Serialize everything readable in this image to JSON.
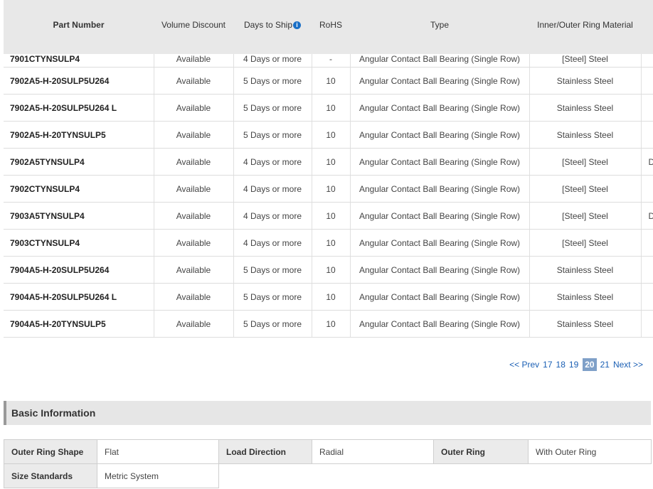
{
  "table": {
    "headers": {
      "part_number": "Part Number",
      "volume_discount": "Volume Discount",
      "days_to_ship": "Days to Ship",
      "rohs": "RoHS",
      "type": "Type",
      "ring_material": "Inner/Outer Ring Material"
    },
    "info_icon_glyph": "i",
    "rows": [
      {
        "part": "7901CTYNSULP4",
        "discount": "Available",
        "ship": "4 Days or more",
        "rohs": "-",
        "type": "Angular Contact Ball Bearing (Single Row)",
        "material": "[Steel] Steel",
        "extra": ""
      },
      {
        "part": "7902A5-H-20SULP5U264",
        "discount": "Available",
        "ship": "5 Days or more",
        "rohs": "10",
        "type": "Angular Contact Ball Bearing (Single Row)",
        "material": "Stainless Steel",
        "extra": ""
      },
      {
        "part": "7902A5-H-20SULP5U264 L",
        "discount": "Available",
        "ship": "5 Days or more",
        "rohs": "10",
        "type": "Angular Contact Ball Bearing (Single Row)",
        "material": "Stainless Steel",
        "extra": ""
      },
      {
        "part": "7902A5-H-20TYNSULP5",
        "discount": "Available",
        "ship": "5 Days or more",
        "rohs": "10",
        "type": "Angular Contact Ball Bearing (Single Row)",
        "material": "Stainless Steel",
        "extra": ""
      },
      {
        "part": "7902A5TYNSULP4",
        "discount": "Available",
        "ship": "4 Days or more",
        "rohs": "10",
        "type": "Angular Contact Ball Bearing (Single Row)",
        "material": "[Steel] Steel",
        "extra": "D"
      },
      {
        "part": "7902CTYNSULP4",
        "discount": "Available",
        "ship": "4 Days or more",
        "rohs": "10",
        "type": "Angular Contact Ball Bearing (Single Row)",
        "material": "[Steel] Steel",
        "extra": ""
      },
      {
        "part": "7903A5TYNSULP4",
        "discount": "Available",
        "ship": "4 Days or more",
        "rohs": "10",
        "type": "Angular Contact Ball Bearing (Single Row)",
        "material": "[Steel] Steel",
        "extra": "D"
      },
      {
        "part": "7903CTYNSULP4",
        "discount": "Available",
        "ship": "4 Days or more",
        "rohs": "10",
        "type": "Angular Contact Ball Bearing (Single Row)",
        "material": "[Steel] Steel",
        "extra": ""
      },
      {
        "part": "7904A5-H-20SULP5U264",
        "discount": "Available",
        "ship": "5 Days or more",
        "rohs": "10",
        "type": "Angular Contact Ball Bearing (Single Row)",
        "material": "Stainless Steel",
        "extra": ""
      },
      {
        "part": "7904A5-H-20SULP5U264 L",
        "discount": "Available",
        "ship": "5 Days or more",
        "rohs": "10",
        "type": "Angular Contact Ball Bearing (Single Row)",
        "material": "Stainless Steel",
        "extra": ""
      },
      {
        "part": "7904A5-H-20TYNSULP5",
        "discount": "Available",
        "ship": "5 Days or more",
        "rohs": "10",
        "type": "Angular Contact Ball Bearing (Single Row)",
        "material": "Stainless Steel",
        "extra": ""
      }
    ]
  },
  "pagination": {
    "prev": "<< Prev",
    "pages": [
      "17",
      "18",
      "19",
      "20",
      "21"
    ],
    "current": "20",
    "next": "Next >>"
  },
  "basic_info": {
    "title": "Basic Information",
    "outer_ring_shape_label": "Outer Ring Shape",
    "outer_ring_shape_value": "Flat",
    "load_direction_label": "Load Direction",
    "load_direction_value": "Radial",
    "outer_ring_label": "Outer Ring",
    "outer_ring_value": "With Outer Ring",
    "size_standards_label": "Size Standards",
    "size_standards_value": "Metric System"
  },
  "colors": {
    "header_bg": "#e8e8e8",
    "link": "#1a5fb4",
    "current_page_bg": "#7fa0c8",
    "info_icon": "#1a6fc6"
  }
}
